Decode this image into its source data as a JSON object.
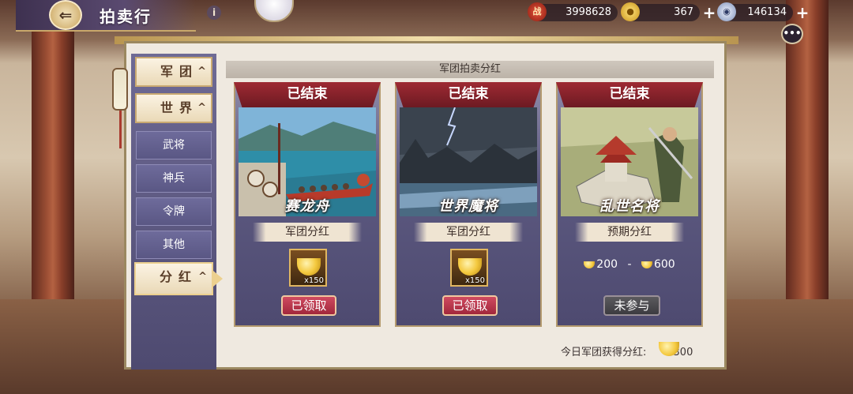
{
  "header": {
    "title": "拍卖行",
    "back_icon": "back-arrow-icon",
    "info_icon": "info-icon"
  },
  "resources": [
    {
      "icon": "power-icon",
      "icon_text": "战",
      "value": "3998628"
    },
    {
      "icon": "gold-ingot-icon",
      "value": "367",
      "plus": "+"
    },
    {
      "icon": "silver-coin-icon",
      "value": "146134",
      "plus": "+"
    }
  ],
  "chat_icon": "•••",
  "sidebar": {
    "main_tabs": [
      {
        "label": "军团",
        "chevron": "^"
      },
      {
        "label": "世界",
        "chevron": "^"
      }
    ],
    "sub_tabs": [
      "武将",
      "神兵",
      "令牌",
      "其他"
    ],
    "active_tab": {
      "label": "分红",
      "chevron": "^"
    }
  },
  "content": {
    "header": "军团拍卖分红",
    "cards": [
      {
        "status": "已结束",
        "name": "赛龙舟",
        "subtitle": "军团分红",
        "reward_qty": "x150",
        "button": "已领取"
      },
      {
        "status": "已结束",
        "name": "世界魔将",
        "subtitle": "军团分红",
        "reward_qty": "x150",
        "button": "已领取"
      },
      {
        "status": "已结束",
        "name": "乱世名将",
        "subtitle": "预期分红",
        "range_min": "200",
        "range_sep": "-",
        "range_max": "600",
        "button": "未参与"
      }
    ],
    "footer_label": "今日军团获得分红:",
    "footer_value": "300"
  },
  "colors": {
    "banner_red": "#9e2a33",
    "claimed_button": "#cf4a60",
    "sidebar_purple": "#5a5784",
    "gold": "#f4c93f"
  }
}
